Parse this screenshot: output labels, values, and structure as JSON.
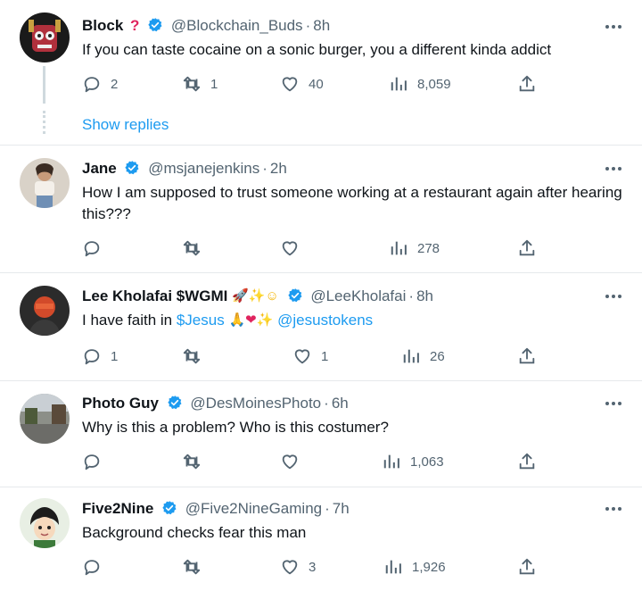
{
  "tweets": [
    {
      "name": "Block",
      "name_suffix": "?",
      "handle": "@Blockchain_Buds",
      "time": "8h",
      "text": "If you can taste cocaine on a sonic burger, you a different kinda addict",
      "replies": "2",
      "retweets": "1",
      "likes": "40",
      "views": "8,059",
      "show_replies": "Show replies"
    },
    {
      "name": "Jane",
      "handle": "@msjanejenkins",
      "time": "2h",
      "text": "How I am supposed to trust someone working at a restaurant again after hearing this???",
      "replies": "",
      "retweets": "",
      "likes": "",
      "views": "278"
    },
    {
      "name": "Lee Kholafai $WGMI",
      "handle": "@LeeKholafai",
      "time": "8h",
      "text_prefix": "I have faith in ",
      "text_cashtag": "$Jesus",
      "text_mention": "@jesustokens",
      "replies": "1",
      "retweets": "",
      "likes": "1",
      "views": "26"
    },
    {
      "name": "Photo Guy",
      "handle": "@DesMoinesPhoto",
      "time": "6h",
      "text": "Why is this a problem? Who is this costumer?",
      "replies": "",
      "retweets": "",
      "likes": "",
      "views": "1,063"
    },
    {
      "name": "Five2Nine",
      "handle": "@Five2NineGaming",
      "time": "7h",
      "text": "Background checks fear this man",
      "replies": "",
      "retweets": "",
      "likes": "3",
      "views": "1,926"
    }
  ],
  "icons": {
    "reply": "reply-icon",
    "retweet": "retweet-icon",
    "like": "heart-icon",
    "views": "views-icon",
    "share": "share-icon",
    "more": "more-icon",
    "verified": "verified-badge-icon"
  },
  "colors": {
    "accent": "#1d9bf0",
    "muted": "#536471",
    "divider": "#e6e9ec",
    "question_mark": "#e0245e"
  }
}
